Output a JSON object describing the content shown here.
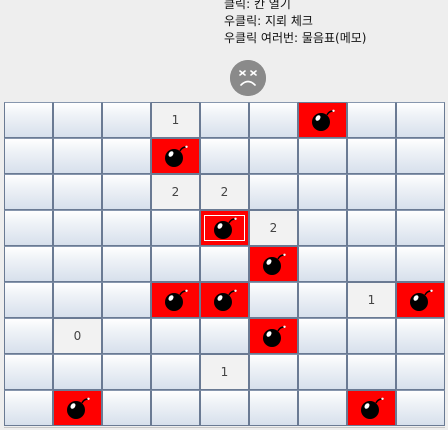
{
  "instructions": [
    "클릭: 칸 열기",
    "우클릭: 지뢰 체크",
    "우클릭 여러번: 물음표(메모)"
  ],
  "face": {
    "icon": "dizzy-face-icon",
    "state": "lost"
  },
  "board": {
    "rows": 9,
    "cols": 9,
    "cells": [
      [
        "h",
        "h",
        "h",
        "1",
        "h",
        "h",
        "m",
        "h",
        "h"
      ],
      [
        "h",
        "h",
        "h",
        "m",
        "h",
        "h",
        "h",
        "h",
        "h"
      ],
      [
        "h",
        "h",
        "h",
        "2",
        "2",
        "h",
        "h",
        "h",
        "h"
      ],
      [
        "h",
        "h",
        "h",
        "h",
        "x",
        "2",
        "h",
        "h",
        "h"
      ],
      [
        "h",
        "h",
        "h",
        "h",
        "h",
        "m",
        "h",
        "h",
        "h"
      ],
      [
        "h",
        "h",
        "h",
        "m",
        "m",
        "h",
        "h",
        "1",
        "m"
      ],
      [
        "h",
        "0",
        "h",
        "h",
        "h",
        "m",
        "h",
        "h",
        "h"
      ],
      [
        "h",
        "h",
        "h",
        "h",
        "1",
        "h",
        "h",
        "h",
        "h"
      ],
      [
        "h",
        "m",
        "h",
        "h",
        "h",
        "h",
        "h",
        "m",
        "h"
      ]
    ],
    "legend": {
      "h": "hidden",
      "m": "mine",
      "x": "exploded-mine",
      "digit": "revealed-count"
    }
  },
  "colors": {
    "mine_bg": "#ff0000",
    "grid_border": "#6a7a93",
    "face": "#8a8a8a"
  }
}
